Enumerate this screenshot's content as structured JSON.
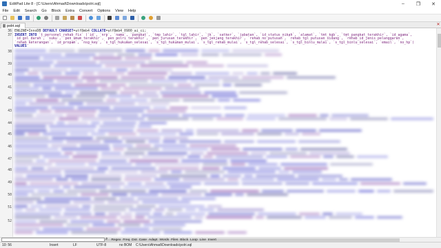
{
  "window": {
    "title": "EditPad Lite 8 - [C:\\Users\\Ahmad\\Downloads\\polri.sql]",
    "minimize": "–",
    "maximize": "❐",
    "close": "✕"
  },
  "menu": [
    "File",
    "Edit",
    "Search",
    "Go",
    "Block",
    "Extra",
    "Convert",
    "Options",
    "View",
    "Help"
  ],
  "toolbar": {
    "icons": [
      "new-file-icon",
      "open-file-icon",
      "save-icon",
      "save-all-icon",
      "undo-icon",
      "redo-icon",
      "cut-icon",
      "copy-icon",
      "paste-icon",
      "delete-icon",
      "find-icon",
      "replace-icon",
      "block-icon",
      "word-wrap-icon",
      "column-icon",
      "font-icon",
      "toggle-icon",
      "clock-icon",
      "settings-icon"
    ]
  },
  "tab": {
    "label": "polri.sql",
    "close": "✕"
  },
  "editor": {
    "line_numbers": [
      "36",
      "37",
      "38",
      "39",
      "40",
      "41",
      "42",
      "43",
      "44",
      "45",
      "46",
      "47",
      "48",
      "49",
      "50",
      "51",
      "52"
    ],
    "line36": {
      "t1": " ENGINE=InnoDB ",
      "k1": "DEFAULT CHARSET",
      "t2": "=utf8mb4 ",
      "k2": "COLLATE",
      "t3": "=utf8mb4_0900_ai_ci;"
    },
    "line37_kw": "INSERT INTO",
    "line37_rest": " `t_personel_rehab_fix` (`id`, `nrp`, `nama`, `pangkat`, `tmp_lahir`, `tgl_lahir`, `jk`, `satker`, `jabatan`, `id_status_nikah`, `alamat`, `tmt_kgb`, `tmt_pangkat_terakhir`, `id_agama`,",
    "line37b": " `id_gol_darah`, `suku`, `pen_umum_terakhir`, `pen_polri_terakhir`, `pen_jurusan_terakhir`, `pen_jenjang_terakhir`, `rehab_no_putusan`, `rehab_tgl_putusan_sidang`, `rehab_id_jenis_pelanggaran`,",
    "line37c": " `rehab_keterangan`, `id_propam`, `nsg_key`, `s_tgl_hukuman_selesai`, `s_tgl_hukuman_mulai`, `s_tgl_rehab_mulai`, `s_tgl_rehab_selesai`, `s_tgl_binlu_mulai`, `s_tgl_binlu_selesai`, `email`, `no_hp`)",
    "line37d": "VALUES"
  },
  "find": {
    "search_placeholder": "",
    "options": [
      "Regex",
      "Freq",
      "Dot",
      "Case",
      "Adapt",
      "Words",
      "Files",
      "Block",
      "Loop",
      "Line",
      "Invert"
    ]
  },
  "status": {
    "position": "10: 56",
    "mode": "Insert",
    "line_break": "LF",
    "encoding": "UTF-8",
    "bom": "no BOM",
    "path": "C:\\Users\\Ahmad\\Downloads\\polri.sql"
  }
}
